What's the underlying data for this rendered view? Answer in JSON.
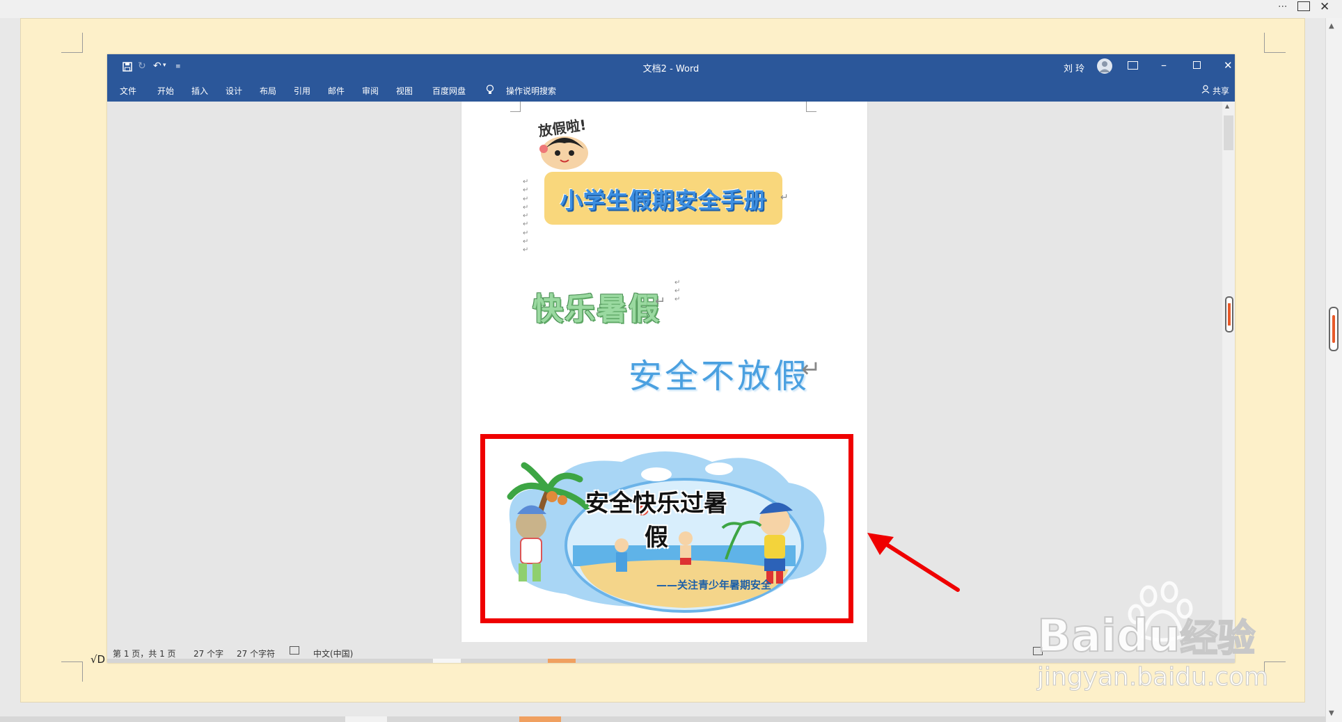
{
  "host": {
    "menu_icon": "more-icon",
    "window_icon": "restore-window-icon",
    "close_icon": "close-icon",
    "left_fragment": "√D"
  },
  "word": {
    "title": "文档2 - Word",
    "user_name": "刘 玲",
    "quick_access": {
      "save_icon": "save-icon",
      "redo_icon": "redo-icon",
      "undo_icon": "undo-icon",
      "customize_icon": "customize-icon"
    },
    "ribbon_tabs": [
      "文件",
      "开始",
      "插入",
      "设计",
      "布局",
      "引用",
      "邮件",
      "审阅",
      "视图",
      "百度网盘"
    ],
    "tell_me": "操作说明搜索",
    "share": "共享",
    "document": {
      "handwriting": "放假啦!",
      "booklet_title": "小学生假期安全手册",
      "happy_summer": "快乐暑假",
      "safety_slogan": "安全不放假",
      "image_title": "安全快乐过暑假",
      "image_subtitle": "——关注青少年暑期安全",
      "paragraph_mark": "↵"
    },
    "status": {
      "page": "第 1 页，共 1 页",
      "words": "27 个字",
      "chars": "27 个字符",
      "language": "中文(中国)"
    }
  },
  "watermark": {
    "brand": "Bai",
    "brand2": "du",
    "brand3": "经验",
    "url": "jingyan.baidu.com"
  },
  "colors": {
    "word_blue": "#2b579a",
    "highlight_red": "#ef0000",
    "host_page": "#fdf0c9"
  }
}
